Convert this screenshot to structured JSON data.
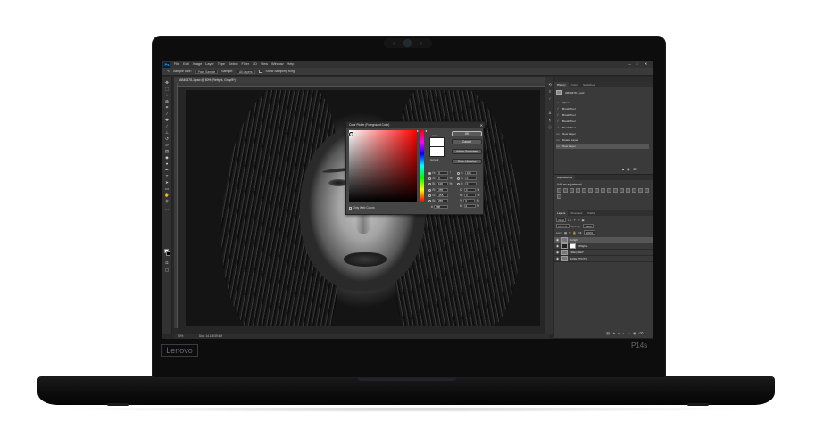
{
  "device": {
    "brand": "Lenovo",
    "model": "P14s"
  },
  "app": {
    "logo": "Ps",
    "menu": [
      "File",
      "Edit",
      "Image",
      "Layer",
      "Type",
      "Select",
      "Filter",
      "3D",
      "View",
      "Window",
      "Help"
    ],
    "window_controls": [
      "—",
      "□",
      "✕"
    ]
  },
  "options_bar": {
    "sample_size_label": "Sample Size:",
    "sample_size_value": "Point Sample",
    "sample_label": "Sample:",
    "sample_value": "All Layers",
    "show_ring_label": "Show Sampling Ring"
  },
  "document": {
    "tab_label": "AB40478-1.psd @ 50% (Refight, Gray/8*) *",
    "zoom": "50%",
    "doc_info": "Doc: 14.1M/39.6M"
  },
  "color_picker": {
    "title": "Color Picker (Foreground Color)",
    "close": "✕",
    "new_label": "new",
    "current_label": "current",
    "ok": "OK",
    "cancel": "Cancel",
    "add_swatches": "Add to Swatches",
    "color_libraries": "Color Libraries",
    "only_web_colors": "Only Web Colors",
    "fields": [
      {
        "label": "H:",
        "value": "0",
        "unit": "°",
        "label2": "L:",
        "value2": "100"
      },
      {
        "label": "S:",
        "value": "0",
        "unit": "%",
        "label2": "a:",
        "value2": "0"
      },
      {
        "label": "B:",
        "value": "100",
        "unit": "%",
        "label2": "b:",
        "value2": "0"
      },
      {
        "label": "R:",
        "value": "255",
        "unit": "",
        "label2": "C:",
        "value2": "0",
        "unit2": "%"
      },
      {
        "label": "G:",
        "value": "255",
        "unit": "",
        "label2": "M:",
        "value2": "0",
        "unit2": "%"
      },
      {
        "label": "B:",
        "value": "255",
        "unit": "",
        "label2": "Y:",
        "value2": "0",
        "unit2": "%"
      },
      {
        "label": "#",
        "value": "ffffff",
        "unit": "",
        "label2": "K:",
        "value2": "0",
        "unit2": "%"
      }
    ]
  },
  "history_panel": {
    "tabs": [
      "History",
      "Color",
      "Swatches"
    ],
    "snapshot": "AB40478-1.psd",
    "items": [
      "Open",
      "Brush Tool",
      "Brush Tool",
      "Brush Tool",
      "Brush Tool",
      "New Layer",
      "Delete Layer",
      "New Layer"
    ]
  },
  "adjustments_panel": {
    "tabs": [
      "Adjustments"
    ],
    "title": "Add an adjustment"
  },
  "layers_panel": {
    "tabs": [
      "Layers",
      "Channels",
      "Paths"
    ],
    "kind": "Kind",
    "blend_mode": "Normal",
    "opacity_label": "Opacity:",
    "opacity_value": "100%",
    "lock_label": "Lock:",
    "fill_label": "Fill:",
    "fill_value": "100%",
    "layers": [
      {
        "name": "Refight",
        "selected": true
      },
      {
        "name": "Offlights",
        "selected": false
      },
      {
        "name": "FREQ SEP",
        "selected": false
      },
      {
        "name": "BASE PHOTO",
        "selected": false
      }
    ]
  }
}
